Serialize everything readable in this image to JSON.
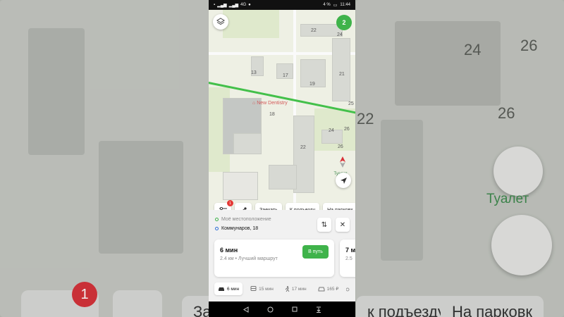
{
  "status_bar": {
    "battery": "4 %",
    "time": "11:44",
    "network": "4G"
  },
  "map": {
    "layers_icon": "layers-icon",
    "badge_count": "2",
    "poi_name": "New Dentistry",
    "toilet_label": "Туалет",
    "house_numbers": [
      "22",
      "24",
      "13",
      "17",
      "19",
      "21",
      "25",
      "18",
      "24",
      "26",
      "22",
      "26"
    ]
  },
  "chips": {
    "filter_badge": "1",
    "stop_label": "Заехать",
    "entrance_label": "К подъезду",
    "parking_label": "На парковк"
  },
  "route": {
    "from": "Моё местоположение",
    "to": "Коммунаров, 18",
    "card1": {
      "time": "6 мин",
      "subtitle": "2.4 км • Лучший маршрут",
      "go_label": "В путь"
    },
    "card2": {
      "time": "7 м",
      "subtitle": "2.5"
    }
  },
  "modes": [
    {
      "label": "6 мин",
      "icon": "car-icon",
      "active": true
    },
    {
      "label": "15 мин",
      "icon": "bus-icon",
      "active": false
    },
    {
      "label": "17 мин",
      "icon": "walk-icon",
      "active": false
    },
    {
      "label": "165 ₽",
      "icon": "taxi-icon",
      "active": false
    }
  ],
  "background": {
    "numbers": [
      "24",
      "26",
      "22",
      "26"
    ],
    "toilet": "Туалет",
    "badge": "1",
    "chip_left": "За",
    "chip_mid": "к подъезду",
    "chip_right": "На парковк"
  },
  "colors": {
    "accent_green": "#3fb34a",
    "route_green": "#43c04a",
    "badge_red": "#e53935",
    "poi_red": "#d35959"
  }
}
